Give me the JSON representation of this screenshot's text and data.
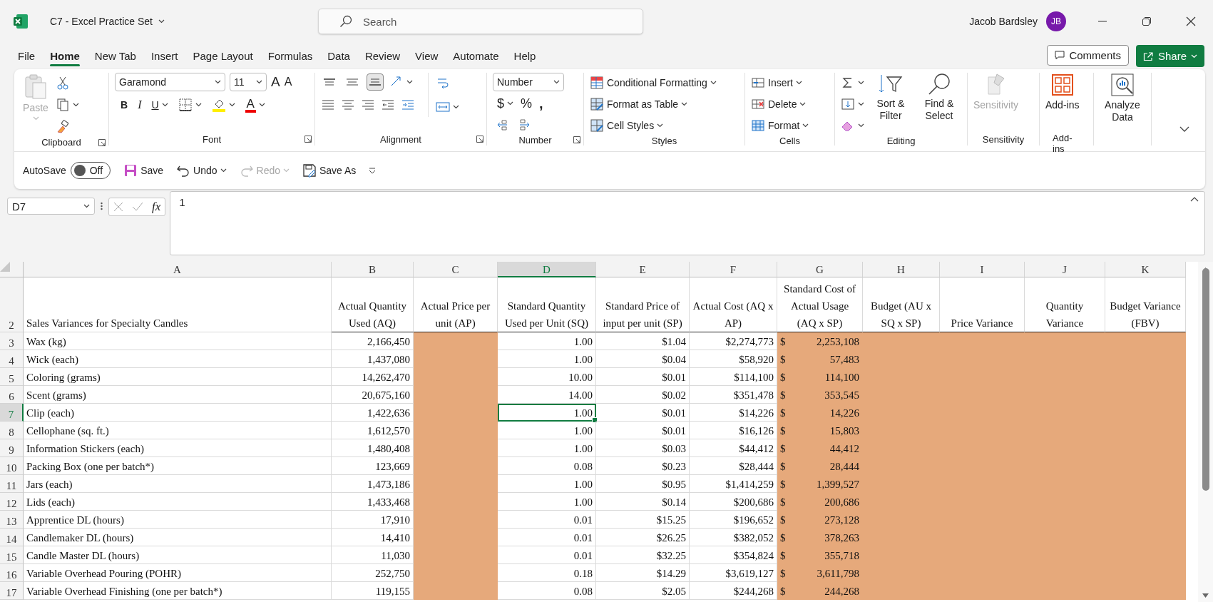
{
  "title_bar": {
    "file_name": "C7 - Excel Practice Set",
    "search_placeholder": "Search",
    "user_name": "Jacob Bardsley",
    "user_initials": "JB"
  },
  "menu_tabs": [
    {
      "label": "File",
      "selected": false
    },
    {
      "label": "Home",
      "selected": true
    },
    {
      "label": "New Tab",
      "selected": false
    },
    {
      "label": "Insert",
      "selected": false
    },
    {
      "label": "Page Layout",
      "selected": false
    },
    {
      "label": "Formulas",
      "selected": false
    },
    {
      "label": "Data",
      "selected": false
    },
    {
      "label": "Review",
      "selected": false
    },
    {
      "label": "View",
      "selected": false
    },
    {
      "label": "Automate",
      "selected": false
    },
    {
      "label": "Help",
      "selected": false
    }
  ],
  "actions": {
    "comments": "Comments",
    "share": "Share"
  },
  "ribbon": {
    "clipboard": {
      "paste": "Paste",
      "label": "Clipboard"
    },
    "font": {
      "font_name": "Garamond",
      "font_size": "11",
      "grow": "A",
      "shrink": "A",
      "bold": "B",
      "italic": "I",
      "underline": "U",
      "font_color": "A",
      "label": "Font"
    },
    "alignment": {
      "vertical": [
        {
          "selected": false
        },
        {
          "selected": false
        },
        {
          "selected": true
        }
      ],
      "label": "Alignment"
    },
    "number": {
      "format": "Number",
      "currency": "$",
      "percent": "%",
      "comma": ",",
      "label": "Number"
    },
    "styles": {
      "items": [
        "Conditional Formatting",
        "Format as Table",
        "Cell Styles"
      ],
      "label": "Styles"
    },
    "cells": {
      "items": [
        "Insert",
        "Delete",
        "Format"
      ],
      "label": "Cells"
    },
    "editing": {
      "sort": "Sort & Filter",
      "find": "Find & Select",
      "label": "Editing"
    },
    "sensitivity": {
      "button": "Sensitivity",
      "disabled": true,
      "label": "Sensitivity"
    },
    "addins": {
      "button": "Add-ins",
      "label": "Add-ins"
    },
    "analyze": {
      "button": "Analyze Data"
    }
  },
  "quick_access": {
    "autosave": "AutoSave",
    "autosave_on": false,
    "autosave_state": "Off",
    "save": "Save",
    "undo": "Undo",
    "redo": "Redo",
    "redo_disabled": true,
    "save_as": "Save As"
  },
  "formula_bar": {
    "name_box": "D7",
    "fx": "fx",
    "formula": "1"
  },
  "sheet": {
    "columns": [
      {
        "letter": "A",
        "selected": false,
        "shaded": false
      },
      {
        "letter": "B",
        "selected": false,
        "shaded": false
      },
      {
        "letter": "C",
        "selected": false,
        "shaded": true
      },
      {
        "letter": "D",
        "selected": true,
        "shaded": false
      },
      {
        "letter": "E",
        "selected": false,
        "shaded": false
      },
      {
        "letter": "F",
        "selected": false,
        "shaded": false
      },
      {
        "letter": "G",
        "selected": false,
        "shaded": true
      },
      {
        "letter": "H",
        "selected": false,
        "shaded": true
      },
      {
        "letter": "I",
        "selected": false,
        "shaded": true
      },
      {
        "letter": "J",
        "selected": false,
        "shaded": true
      },
      {
        "letter": "K",
        "selected": false,
        "shaded": true
      }
    ],
    "header_row": {
      "number": "2",
      "cells": {
        "A": "Sales Variances  for Specialty Candles",
        "B": "Actual Quantity Used (AQ)",
        "C": "Actual Price per unit (AP)",
        "D": "Standard Quantity Used per Unit (SQ)",
        "E": "Standard Price of input per unit (SP)",
        "F": "Actual Cost (AQ x AP)",
        "G": "Standard Cost of Actual Usage (AQ x SP)",
        "H": "Budget (AU x SQ x SP)",
        "I": "Price Variance",
        "J": "Quantity Variance",
        "K": "Budget Variance (FBV)"
      }
    },
    "rows": [
      {
        "number": "3",
        "selected": false,
        "cells": {
          "A": "Wax (kg)",
          "B": "2,166,450",
          "D": "1.00",
          "E": "$1.04",
          "F": "$2,274,773",
          "G": {
            "currency": "$",
            "amount": "2,253,108"
          }
        }
      },
      {
        "number": "4",
        "selected": false,
        "cells": {
          "A": "Wick (each)",
          "B": "1,437,080",
          "D": "1.00",
          "E": "$0.04",
          "F": "$58,920",
          "G": {
            "currency": "$",
            "amount": "57,483"
          }
        }
      },
      {
        "number": "5",
        "selected": false,
        "cells": {
          "A": "Coloring (grams)",
          "B": "14,262,470",
          "D": "10.00",
          "E": "$0.01",
          "F": "$114,100",
          "G": {
            "currency": "$",
            "amount": "114,100"
          }
        }
      },
      {
        "number": "6",
        "selected": false,
        "cells": {
          "A": "Scent (grams)",
          "B": "20,675,160",
          "D": "14.00",
          "E": "$0.02",
          "F": "$351,478",
          "G": {
            "currency": "$",
            "amount": "353,545"
          }
        }
      },
      {
        "number": "7",
        "selected": true,
        "cells": {
          "A": "Clip (each)",
          "B": "1,422,636",
          "D": "1.00",
          "E": "$0.01",
          "F": "$14,226",
          "G": {
            "currency": "$",
            "amount": "14,226"
          }
        }
      },
      {
        "number": "8",
        "selected": false,
        "cells": {
          "A": "Cellophane (sq. ft.)",
          "B": "1,612,570",
          "D": "1.00",
          "E": "$0.01",
          "F": "$16,126",
          "G": {
            "currency": "$",
            "amount": "15,803"
          }
        }
      },
      {
        "number": "9",
        "selected": false,
        "cells": {
          "A": "Information Stickers (each)",
          "B": "1,480,408",
          "D": "1.00",
          "E": "$0.03",
          "F": "$44,412",
          "G": {
            "currency": "$",
            "amount": "44,412"
          }
        }
      },
      {
        "number": "10",
        "selected": false,
        "cells": {
          "A": "Packing Box (one per batch*)",
          "B": "123,669",
          "D": "0.08",
          "E": "$0.23",
          "F": "$28,444",
          "G": {
            "currency": "$",
            "amount": "28,444"
          }
        }
      },
      {
        "number": "11",
        "selected": false,
        "cells": {
          "A": "Jars (each)",
          "B": "1,473,186",
          "D": "1.00",
          "E": "$0.95",
          "F": "$1,414,259",
          "G": {
            "currency": "$",
            "amount": "1,399,527"
          }
        }
      },
      {
        "number": "12",
        "selected": false,
        "cells": {
          "A": "Lids (each)",
          "B": "1,433,468",
          "D": "1.00",
          "E": "$0.14",
          "F": "$200,686",
          "G": {
            "currency": "$",
            "amount": "200,686"
          }
        }
      },
      {
        "number": "13",
        "selected": false,
        "cells": {
          "A": "Apprentice DL (hours)",
          "B": "17,910",
          "D": "0.01",
          "E": "$15.25",
          "F": "$196,652",
          "G": {
            "currency": "$",
            "amount": "273,128"
          }
        }
      },
      {
        "number": "14",
        "selected": false,
        "cells": {
          "A": "Candlemaker DL (hours)",
          "B": "14,410",
          "D": "0.01",
          "E": "$26.25",
          "F": "$382,052",
          "G": {
            "currency": "$",
            "amount": "378,263"
          }
        }
      },
      {
        "number": "15",
        "selected": false,
        "cells": {
          "A": "Candle Master DL (hours)",
          "B": "11,030",
          "D": "0.01",
          "E": "$32.25",
          "F": "$354,824",
          "G": {
            "currency": "$",
            "amount": "355,718"
          }
        }
      },
      {
        "number": "16",
        "selected": false,
        "cells": {
          "A": "Variable Overhead Pouring (POHR)",
          "B": "252,750",
          "D": "0.18",
          "E": "$14.29",
          "F": "$3,619,127",
          "G": {
            "currency": "$",
            "amount": "3,611,798"
          }
        }
      },
      {
        "number": "17",
        "selected": false,
        "cells": {
          "A": "Variable Overhead Finishing (one per batch*)",
          "B": "119,155",
          "D": "0.08",
          "E": "$2.05",
          "F": "$244,268",
          "G": {
            "currency": "$",
            "amount": "244,268"
          }
        }
      }
    ]
  }
}
